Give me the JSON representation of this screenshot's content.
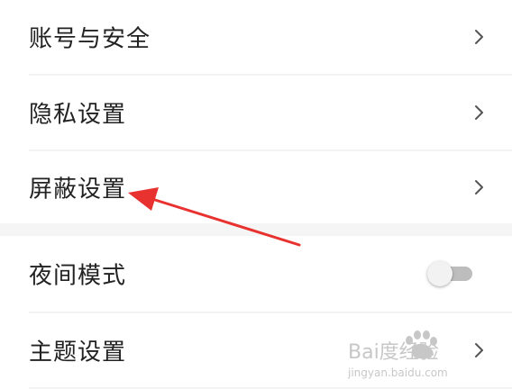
{
  "settings": {
    "items": [
      {
        "label": "账号与安全",
        "control": "chevron"
      },
      {
        "label": "隐私设置",
        "control": "chevron"
      },
      {
        "label": "屏蔽设置",
        "control": "chevron"
      },
      {
        "label": "夜间模式",
        "control": "toggle",
        "toggle_on": false
      },
      {
        "label": "主题设置",
        "control": "chevron"
      }
    ]
  },
  "icons": {
    "chevron": "chevron-right-icon",
    "annotation": "red-arrow-annotation",
    "watermark": "baidu-jingyan-logo"
  },
  "colors": {
    "text": "#222222",
    "chevron": "#555555",
    "divider": "#f3f3f3",
    "section_gap": "#f5f5f5",
    "toggle_off_track": "#bdbdbd",
    "annotation_arrow": "#e8322f"
  },
  "watermark": {
    "line1": "Bai度经验",
    "line2": "jingyan.baidu.com"
  }
}
